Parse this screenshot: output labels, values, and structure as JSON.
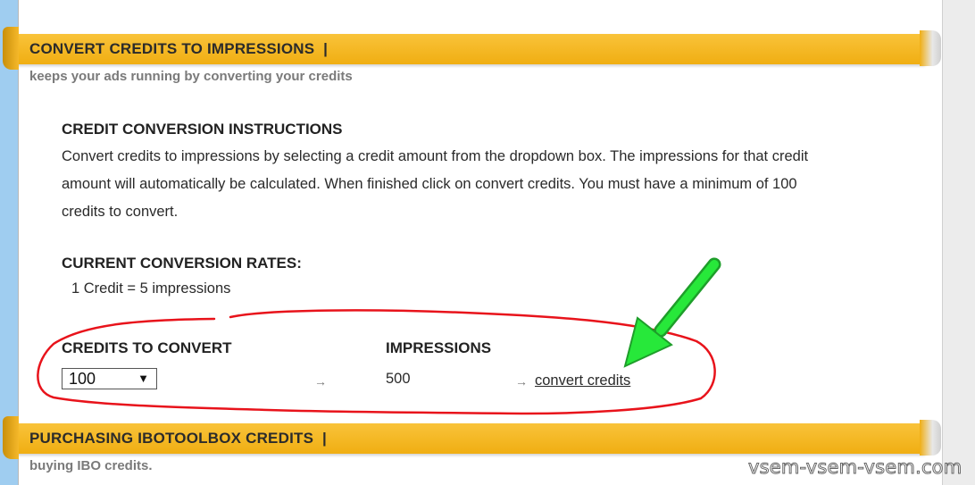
{
  "section1": {
    "title": "CONVERT CREDITS TO IMPRESSIONS",
    "separator": "|",
    "subtitle": "keeps your ads running by converting your credits"
  },
  "instructions": {
    "heading": "CREDIT CONVERSION INSTRUCTIONS",
    "line1": "Convert credits to impressions by selecting a credit amount from the dropdown box. The impressions for that credit",
    "line2": "amount will automatically be calculated. When finished click on convert credits. You must have a minimum of 100",
    "line3": "credits to convert."
  },
  "rates": {
    "heading": "CURRENT CONVERSION RATES:",
    "rate": "1 Credit = 5 impressions"
  },
  "conversion": {
    "credits_label": "CREDITS TO CONVERT",
    "credits_selected": "100",
    "impressions_label": "IMPRESSIONS",
    "impressions_value": "500",
    "arrow": "→",
    "convert_label": "convert credits"
  },
  "section2": {
    "title": "PURCHASING IBOTOOLBOX CREDITS",
    "separator": "|",
    "subtitle": "buying IBO credits."
  },
  "colors": {
    "banner": "#f5b51f",
    "annotation_circle": "#e8131b",
    "annotation_arrow": "#22e233",
    "left_stripe": "#9fcdf0"
  },
  "watermark": "vsem-vsem-vsem.com"
}
